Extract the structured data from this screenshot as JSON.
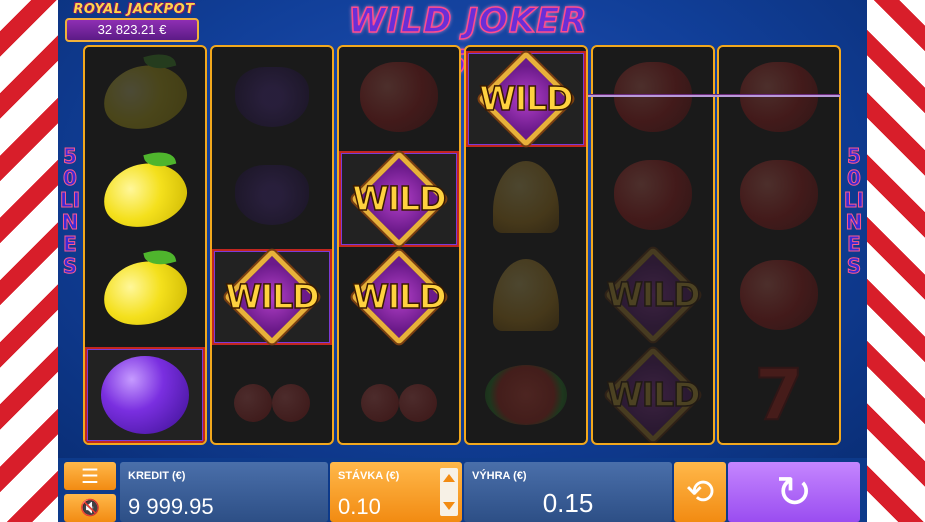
{
  "game": {
    "title": "WILD JOKER 50",
    "lines_label": "50 LINES"
  },
  "jackpot": {
    "title": "ROYAL JACKPOT",
    "amount": "32 823.21 €"
  },
  "reels": [
    [
      "lemon",
      "lemon",
      "lemon",
      "plum"
    ],
    [
      "grapes",
      "grapes",
      "wild",
      "cherry"
    ],
    [
      "apple",
      "wild",
      "wild",
      "cherry"
    ],
    [
      "wild",
      "bell",
      "bell",
      "melon"
    ],
    [
      "apple",
      "apple",
      "wild",
      "wild"
    ],
    [
      "apple",
      "apple",
      "apple",
      "seven"
    ]
  ],
  "wild_label": "WILD",
  "controls": {
    "menu_icon": "menu-icon",
    "sound_icon": "sound-muted-icon",
    "credit_label": "KREDIT (€)",
    "credit_value": "9 999.95",
    "bet_label": "STÁVKA (€)",
    "bet_value": "0.10",
    "win_label": "VÝHRA (€)",
    "win_value": "0.15",
    "autoplay_icon": "autoplay-icon",
    "spin_icon": "spin-icon"
  },
  "colors": {
    "background": "#0d3a8a",
    "accent_orange": "#f28b12",
    "accent_purple": "#9a4df0",
    "stripe_red": "#d81e2a"
  }
}
